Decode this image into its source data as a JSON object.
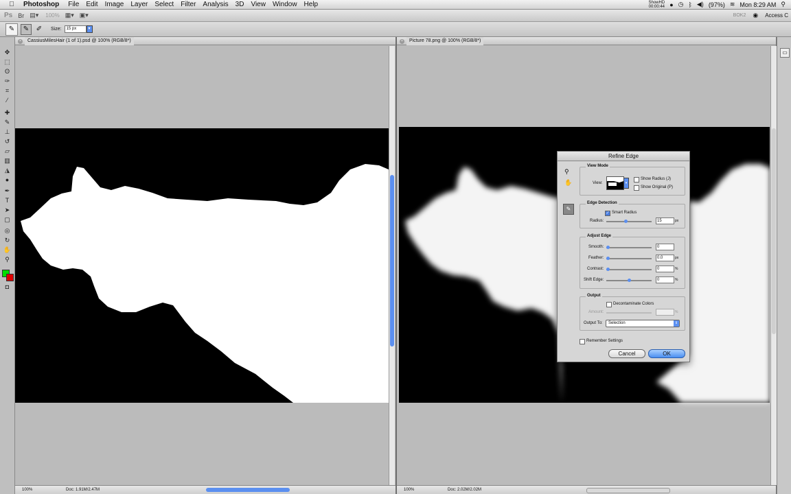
{
  "menubar": {
    "app_name": "Photoshop",
    "items": [
      "File",
      "Edit",
      "Image",
      "Layer",
      "Select",
      "Filter",
      "Analysis",
      "3D",
      "View",
      "Window",
      "Help"
    ],
    "status": {
      "clock": "Mon 8:29 AM",
      "battery": "(97%)",
      "showhd": "ShowHD",
      "showhd_time": "00:00:44"
    }
  },
  "appbar": {
    "ps_label": "Ps",
    "zoom": "100%",
    "workspace": "BOK2",
    "access": "Access C"
  },
  "options": {
    "size_label": "Size:",
    "size_value": "15 px"
  },
  "left_doc": {
    "tab_title": "CassiusMilesHair (1 of 1).psd @ 100% (RGB/8*)",
    "zoom": "100%",
    "doc_info": "Doc: 1.91M/2.47M"
  },
  "right_doc": {
    "tab_title": "Picture 78.png @ 100% (RGB/8*)",
    "zoom": "100%",
    "doc_info": "Doc: 2.02M/2.02M"
  },
  "dialog": {
    "title": "Refine Edge",
    "view_mode": {
      "label": "View Mode",
      "view_label": "View:",
      "show_radius": "Show Radius (J)",
      "show_original": "Show Original (P)"
    },
    "edge_detection": {
      "label": "Edge Detection",
      "smart_radius": "Smart Radius",
      "smart_radius_checked": true,
      "radius_label": "Radius:",
      "radius_value": "15",
      "radius_unit": "px",
      "radius_fraction": 0.43
    },
    "adjust_edge": {
      "label": "Adjust Edge",
      "smooth": {
        "label": "Smooth:",
        "value": "0",
        "fraction": 0.0
      },
      "feather": {
        "label": "Feather:",
        "value": "0.0",
        "unit": "px",
        "fraction": 0.0
      },
      "contrast": {
        "label": "Contrast:",
        "value": "0",
        "unit": "%",
        "fraction": 0.0
      },
      "shift_edge": {
        "label": "Shift Edge:",
        "value": "0",
        "unit": "%",
        "fraction": 0.5
      }
    },
    "output": {
      "label": "Output",
      "decontaminate": "Decontaminate Colors",
      "amount_label": "Amount:",
      "amount_unit": "%",
      "output_to_label": "Output To:",
      "output_to_value": "Selection"
    },
    "remember": "Remember Settings",
    "cancel": "Cancel",
    "ok": "OK"
  }
}
